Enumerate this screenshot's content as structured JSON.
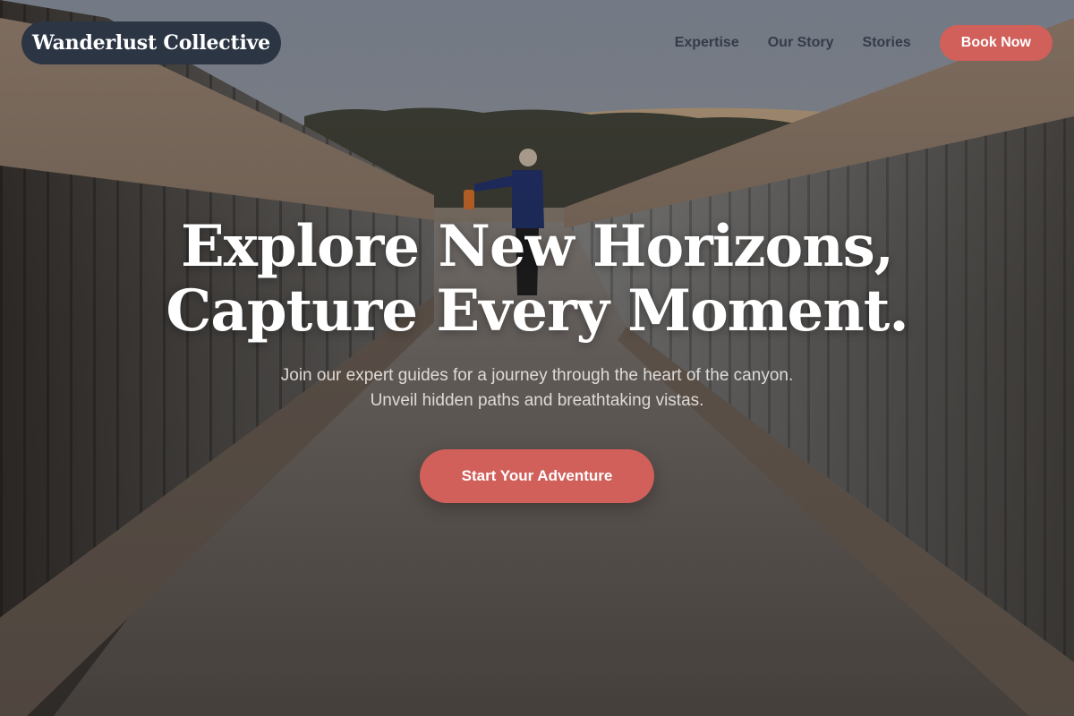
{
  "brand": {
    "name": "Wanderlust Collective"
  },
  "nav": {
    "links": [
      "Expertise",
      "Our Story",
      "Stories"
    ],
    "book_label": "Book Now"
  },
  "hero": {
    "title_line1": "Explore New Horizons,",
    "title_line2": "Capture Every Moment.",
    "subtitle_line1": "Join our expert guides for a journey through the heart of the canyon.",
    "subtitle_line2": "Unveil hidden paths and breathtaking vistas.",
    "cta_label": "Start Your Adventure"
  },
  "colors": {
    "accent": "#d15f5a",
    "brand_pill": "#2b3544",
    "nav_text": "#2f3744"
  }
}
